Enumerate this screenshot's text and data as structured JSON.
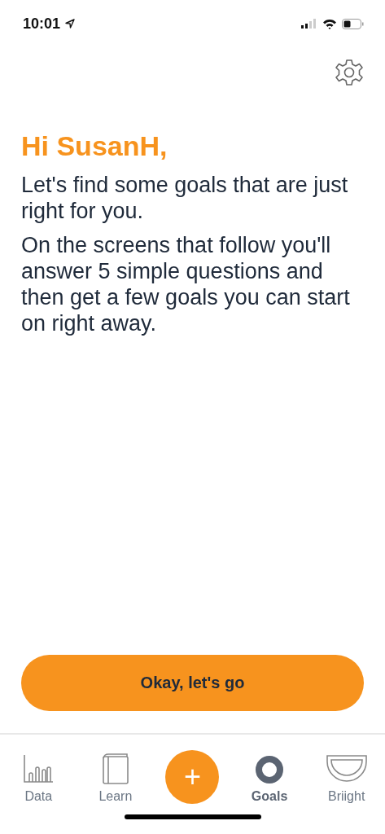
{
  "status_bar": {
    "time": "10:01"
  },
  "greeting": "Hi SusanH,",
  "paragraphs": [
    "Let's find some goals that are just right for you.",
    "On the screens that follow you'll answer 5 simple questions and then get a few goals you can start on right away."
  ],
  "primary_button": "Okay, let's go",
  "tabs": [
    {
      "kind": "data",
      "label": "Data",
      "selected": false
    },
    {
      "kind": "learn",
      "label": "Learn",
      "selected": false
    },
    {
      "kind": "add",
      "label": "+",
      "selected": false
    },
    {
      "kind": "goals",
      "label": "Goals",
      "selected": true
    },
    {
      "kind": "briight",
      "label": "Briight",
      "selected": false
    }
  ]
}
